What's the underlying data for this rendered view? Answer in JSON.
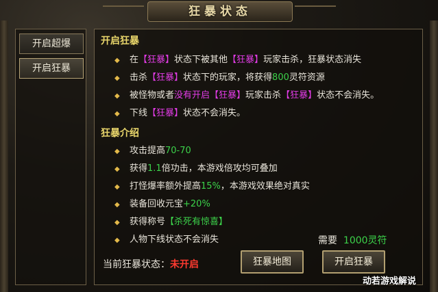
{
  "window": {
    "title": "狂暴状态"
  },
  "sidebar": {
    "tabs": [
      {
        "label": "开启超爆"
      },
      {
        "label": "开启狂暴"
      }
    ]
  },
  "section1": {
    "title": "开启狂暴",
    "lines": [
      {
        "a": "在",
        "b": "【狂暴】",
        "c": "状态下被其他",
        "d": "【狂暴】",
        "e": "玩家击杀，狂暴状态消失"
      },
      {
        "a": "击杀",
        "b": "【狂暴】",
        "c": "状态下的玩家，将获得",
        "d": "800",
        "e": "灵符资源"
      },
      {
        "a": "被怪物或者",
        "b": "没有开启",
        "c": "【狂暴】",
        "d": "玩家击杀",
        "e": "【狂暴】",
        "f": "状态不会消失。"
      },
      {
        "a": "下线",
        "b": "【狂暴】",
        "c": "状态不会消失。"
      }
    ]
  },
  "section2": {
    "title": "狂暴介绍",
    "lines": [
      {
        "a": "攻击提高",
        "b": "70-70"
      },
      {
        "a": "获得",
        "b": "1.1",
        "c": "倍功击，本游戏倍攻均可叠加"
      },
      {
        "a": "打怪爆率额外提高",
        "b": "15%",
        "c": "，本游戏效果绝对真实"
      },
      {
        "a": "装备回收元宝",
        "b": "+20%"
      },
      {
        "a": "获得称号",
        "b": "【杀死有惊喜】"
      },
      {
        "a": "人物下线状态不会消失"
      }
    ]
  },
  "footer": {
    "status_label": "当前狂暴状态：",
    "status_value": "未开启",
    "need_label": "需要",
    "need_value": "1000灵符",
    "map_button": "狂暴地图",
    "activate_button": "开启狂暴"
  },
  "watermark": "动若游戏解说",
  "colors": {
    "magenta": "#e23ce6",
    "green": "#3cd24a",
    "red": "#ff3a30",
    "gold": "#e9d66b"
  },
  "icons": {
    "bullet": "diamond-bullet-icon"
  }
}
